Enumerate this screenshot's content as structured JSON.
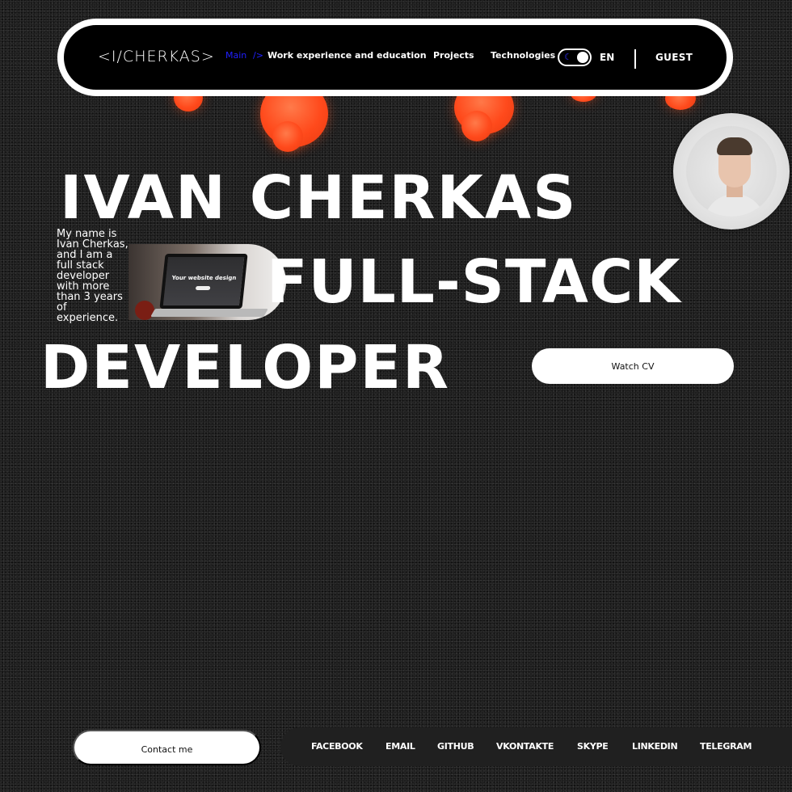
{
  "header": {
    "logo": "<I/CHERKAS>",
    "nav": {
      "main": "Main",
      "main_tag": "/>",
      "experience": "Work experience and education",
      "projects": "Projects",
      "technologies": "Technologies"
    },
    "theme_toggle": {
      "icon": "moon-icon",
      "state": "dark"
    },
    "language": "EN",
    "user": "GUEST"
  },
  "hero": {
    "line1": "IVAN CHERKAS",
    "line2": "FULL-STACK",
    "line3": "DEVELOPER",
    "intro": "My name is Ivan Cherkas, and I am a full stack developer with more than 3 years of experience.",
    "image_caption": "Your website design",
    "watch_cv": "Watch CV"
  },
  "footer": {
    "contact": "Contact me",
    "socials": [
      "FACEBOOK",
      "EMAIL",
      "GITHUB",
      "VKONTAKTE",
      "SKYPE",
      "LINKEDIN",
      "TELEGRAM"
    ]
  },
  "colors": {
    "accent_orange": "#ff4a1c",
    "nav_active": "#2020ff",
    "background": "#1a1a1a"
  }
}
